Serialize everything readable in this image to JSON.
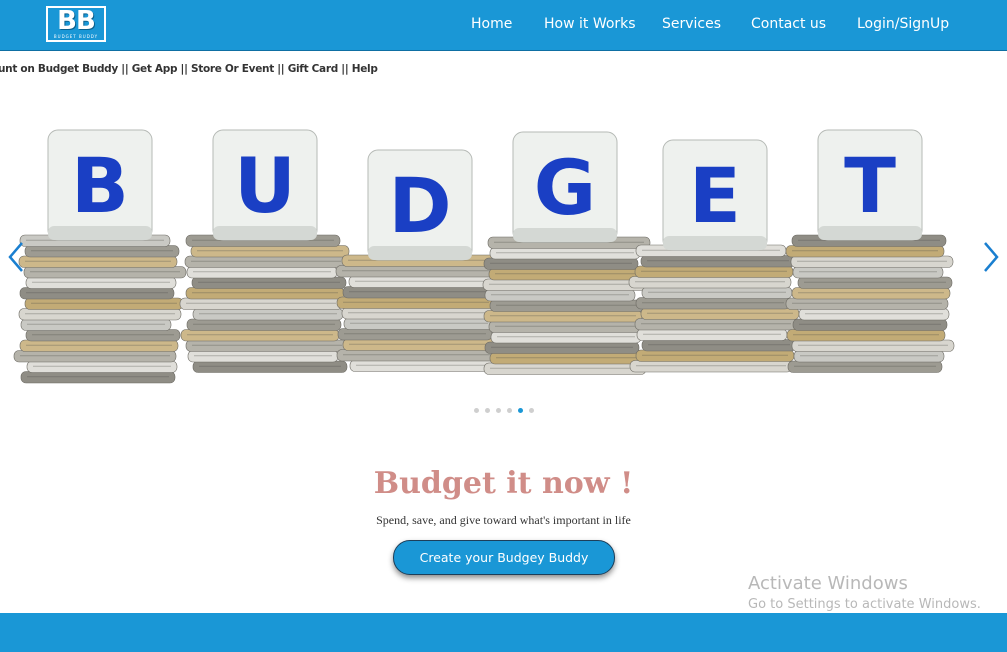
{
  "brand": {
    "logo_letters": "BB",
    "logo_subtext": "BUDGET BUDDY"
  },
  "nav": {
    "items": [
      {
        "label": "Home"
      },
      {
        "label": "How it Works"
      },
      {
        "label": "Services"
      },
      {
        "label": "Contact us"
      },
      {
        "label": "Login/SignUp"
      }
    ]
  },
  "ticker": {
    "text": "unt on Budget Buddy || Get App || Store Or Event || Gift Card || Help"
  },
  "carousel": {
    "slide_letters": [
      "B",
      "U",
      "D",
      "G",
      "E",
      "T"
    ],
    "slide_count": 6,
    "active_index": 4,
    "prev_icon": "chevron-left-icon",
    "next_icon": "chevron-right-icon"
  },
  "hero": {
    "title": "Budget it now !",
    "subtitle": "Spend, save, and give toward what's important in life",
    "cta_label": "Create your Budgey Buddy"
  },
  "watermark": {
    "line1": "Activate Windows",
    "line2": "Go to Settings to activate Windows."
  },
  "colors": {
    "primary": "#1a97d6",
    "hero_title": "#d08d88",
    "letter_blue": "#1a3fc4"
  }
}
